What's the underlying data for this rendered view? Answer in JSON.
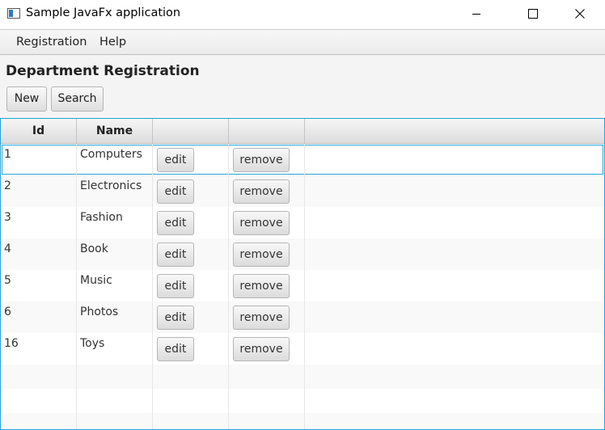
{
  "window": {
    "title": "Sample JavaFx application",
    "icon": "java-app-icon",
    "controls": [
      "minimize-icon",
      "maximize-icon",
      "close-icon"
    ]
  },
  "menu": {
    "items": [
      {
        "label": "Registration"
      },
      {
        "label": "Help"
      }
    ]
  },
  "page": {
    "title": "Department Registration"
  },
  "toolbar": {
    "new_label": "New",
    "search_label": "Search"
  },
  "table": {
    "columns": [
      "Id",
      "Name",
      "",
      "",
      ""
    ],
    "edit_label": "edit",
    "remove_label": "remove",
    "rows": [
      {
        "id": "1",
        "name": "Computers",
        "selected": true
      },
      {
        "id": "2",
        "name": "Electronics"
      },
      {
        "id": "3",
        "name": "Fashion"
      },
      {
        "id": "4",
        "name": "Book"
      },
      {
        "id": "5",
        "name": "Music"
      },
      {
        "id": "6",
        "name": "Photos"
      },
      {
        "id": "16",
        "name": "Toys"
      }
    ]
  },
  "colors": {
    "focus_border": "#2aa1d3",
    "header_bg": "#e4e4e4",
    "row_alt_bg": "#f9f9f9"
  }
}
